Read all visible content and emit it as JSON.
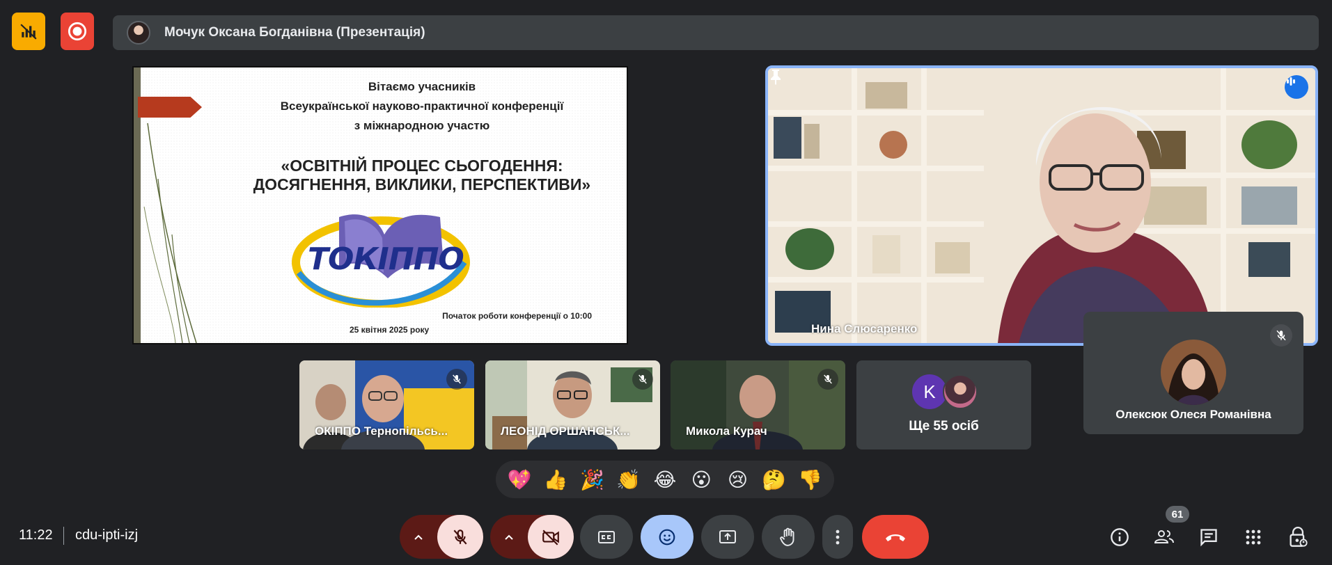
{
  "top_bar": {
    "presenter_title": "Мочук Оксана Богданівна (Презентація)",
    "icons": [
      "stats-icon",
      "record-icon"
    ],
    "colors": {
      "stats": "#f9ab00",
      "record": "#ea4335"
    }
  },
  "slide": {
    "heading_line1": "Вітаємо учасників",
    "heading_line2": "Всеукраїнської науково-практичної конференції",
    "heading_line3": "з міжнародною участю",
    "title_line1": "«ОСВІТНІЙ ПРОЦЕС СЬОГОДЕННЯ:",
    "title_line2": "ДОСЯГНЕННЯ, ВИКЛИКИ, ПЕРСПЕКТИВИ»",
    "logo_text": "ТОКІППО",
    "start_text": "Початок роботи конференції о 10:00",
    "date_text": "25 квітня 2025 року"
  },
  "speaker": {
    "name": "Нина Слюсаренко",
    "border_color": "#8ab4f8"
  },
  "self_tile": {
    "name": "Олексюк Олеся Романівна"
  },
  "participants": [
    {
      "name": "ОКІППО Тернопільсь..."
    },
    {
      "name": "ЛЕОНІД ОРШАНСЬК..."
    },
    {
      "name": "Микола Курач"
    }
  ],
  "more_tile": {
    "initial": "K",
    "label": "Ще 55 осіб"
  },
  "reactions": [
    "💖",
    "👍",
    "🎉",
    "👏",
    "😂",
    "😮",
    "😢",
    "🤔",
    "👎"
  ],
  "bottom_bar": {
    "time": "11:22",
    "meeting_code": "cdu-ipti-izj",
    "people_count": "61",
    "end_call_color": "#ea4335"
  }
}
